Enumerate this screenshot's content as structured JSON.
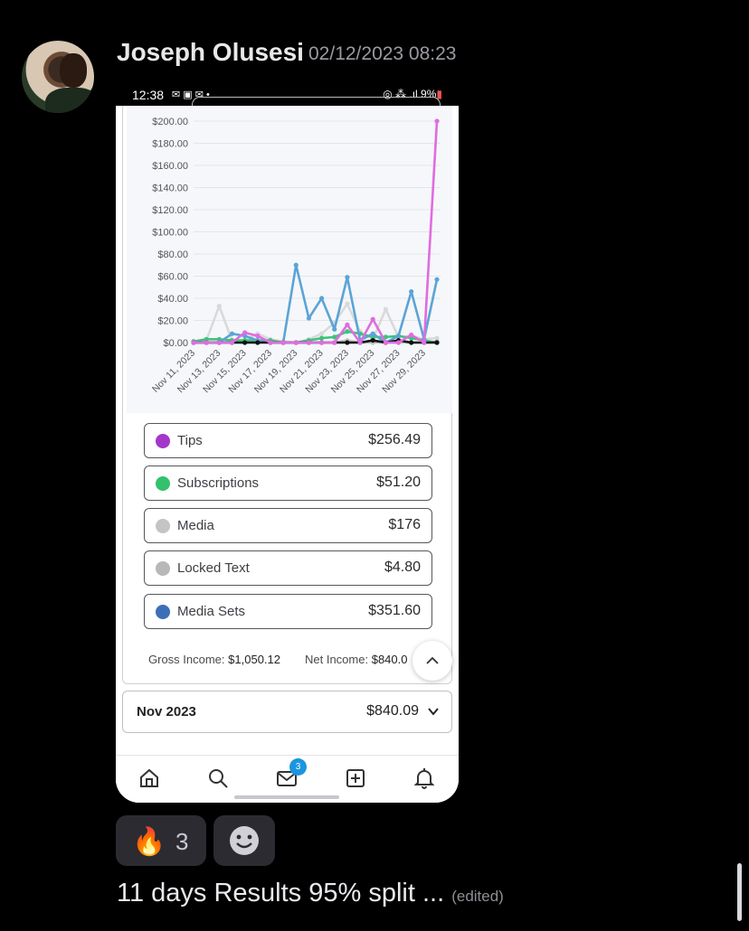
{
  "message": {
    "author": "Joseph Olusesi",
    "timestamp": "02/12/2023 08:23",
    "text": "11 days Results 95% split ...",
    "edited_label": "(edited)"
  },
  "phone_status": {
    "time": "12:38",
    "notification_icons": [
      "mail-icon",
      "image-icon",
      "mail-icon",
      "dot-icon"
    ],
    "right_text": "LTE 9%",
    "battery": "9%"
  },
  "chart_data": {
    "type": "line",
    "ylim": [
      0,
      200
    ],
    "y_ticks": [
      "$200.00",
      "$180.00",
      "$160.00",
      "$140.00",
      "$120.00",
      "$100.00",
      "$80.00",
      "$60.00",
      "$40.00",
      "$20.00",
      "$0.00"
    ],
    "x_tick_labels": [
      "Nov 11, 2023",
      "Nov 13, 2023",
      "Nov 15, 2023",
      "Nov 17, 2023",
      "Nov 19, 2023",
      "Nov 21, 2023",
      "Nov 23, 2023",
      "Nov 25, 2023",
      "Nov 27, 2023",
      "Nov 29, 2023"
    ],
    "n_points": 20,
    "series": [
      {
        "name": "Media",
        "color": "#d9d9d9",
        "values": [
          0,
          2,
          33,
          2,
          2,
          8,
          3,
          1,
          0,
          3,
          8,
          18,
          35,
          10,
          3,
          30,
          5,
          6,
          3,
          4
        ]
      },
      {
        "name": "Locked Text",
        "color": "#c4c4c4",
        "values": [
          0,
          0,
          0,
          0,
          0,
          1,
          0,
          0,
          0,
          0,
          0,
          0,
          2,
          0,
          0,
          0,
          0,
          0,
          0,
          1
        ]
      },
      {
        "name": "Subscriptions",
        "color": "#3cc47a",
        "values": [
          1,
          3,
          3,
          2,
          2,
          2,
          2,
          0,
          0,
          2,
          4,
          5,
          10,
          8,
          5,
          5,
          6,
          4,
          2,
          0
        ]
      },
      {
        "name": "Media Sets",
        "color": "#5ba4d6",
        "values": [
          0,
          0,
          0,
          8,
          6,
          2,
          0,
          0,
          70,
          22,
          40,
          12,
          59,
          2,
          8,
          0,
          6,
          46,
          3,
          57
        ]
      },
      {
        "name": "",
        "color": "#111111",
        "values": [
          0,
          0,
          0,
          0,
          0,
          0,
          0,
          0,
          0,
          0,
          0,
          0,
          0,
          0,
          2,
          0,
          2,
          0,
          0,
          0
        ]
      },
      {
        "name": "Tips",
        "color": "#e16be0",
        "values": [
          0,
          0,
          0,
          0,
          9,
          6,
          0,
          0,
          0,
          0,
          0,
          0,
          16,
          0,
          21,
          0,
          0,
          7,
          0,
          200
        ]
      }
    ]
  },
  "legend": [
    {
      "label": "Tips",
      "value": "$256.49",
      "color": "#a237c9"
    },
    {
      "label": "Subscriptions",
      "value": "$51.20",
      "color": "#33c26b"
    },
    {
      "label": "Media",
      "value": "$176",
      "color": "#c4c4c4"
    },
    {
      "label": "Locked Text",
      "value": "$4.80",
      "color": "#b8b8b8"
    },
    {
      "label": "Media Sets",
      "value": "$351.60",
      "color": "#3d6fb8"
    }
  ],
  "income": {
    "gross_label": "Gross Income:",
    "gross_value": "$1,050.12",
    "net_label": "Net Income:",
    "net_value": "$840.0"
  },
  "month_summary": {
    "month": "Nov 2023",
    "total": "$840.09"
  },
  "navbar": {
    "items": [
      "home-icon",
      "search-icon",
      "messages-icon",
      "add-post-icon",
      "notifications-icon"
    ],
    "messages_badge": "3"
  },
  "reactions": [
    {
      "emoji": "🔥",
      "count": "3"
    },
    {
      "emoji": "add-reaction-icon",
      "count": ""
    }
  ]
}
